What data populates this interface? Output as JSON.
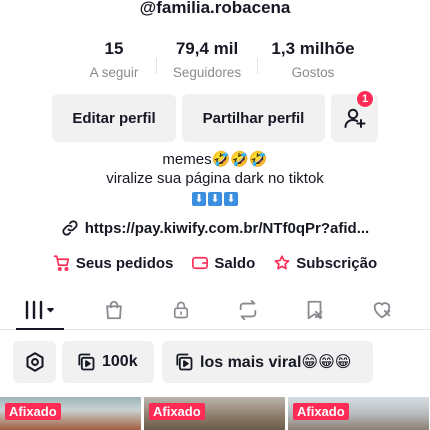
{
  "profile": {
    "username": "@familia.robacena"
  },
  "stats": [
    {
      "value": "15",
      "label": "A seguir"
    },
    {
      "value": "79,4 mil",
      "label": "Seguidores"
    },
    {
      "value": "1,3 milhõe",
      "label": "Gostos"
    }
  ],
  "actions": {
    "edit_label": "Editar perfil",
    "share_label": "Partilhar perfil",
    "add_friends_badge": "1"
  },
  "bio": {
    "line1": "memes🤣🤣🤣",
    "line2": "viralize sua página dark no tiktok",
    "arrows": [
      "⬇",
      "⬇",
      "⬇"
    ]
  },
  "link": {
    "text": "https://pay.kiwify.com.br/NTf0qPr?afid..."
  },
  "quick_links": [
    {
      "label": "Seus pedidos",
      "icon": "cart-icon"
    },
    {
      "label": "Saldo",
      "icon": "wallet-icon"
    },
    {
      "label": "Subscrição",
      "icon": "star-badge-icon"
    }
  ],
  "tabs": [
    {
      "icon": "grid-filter-icon",
      "active": true
    },
    {
      "icon": "shopping-bag-icon"
    },
    {
      "icon": "lock-icon"
    },
    {
      "icon": "repost-icon"
    },
    {
      "icon": "bookmark-icon"
    },
    {
      "icon": "heart-icon"
    }
  ],
  "playlists": [
    {
      "icon": "settings-icon",
      "label": ""
    },
    {
      "icon": "playlist-icon",
      "label": "100k"
    },
    {
      "icon": "playlist-icon",
      "label": "los mais viral😁😁😁"
    }
  ],
  "videos": [
    {
      "pinned_label": "Afixado"
    },
    {
      "pinned_label": "Afixado"
    },
    {
      "pinned_label": "Afixado"
    }
  ],
  "colors": {
    "accent": "#fe2c55",
    "text": "#161823",
    "muted": "#8a8b91",
    "button_bg": "#f1f1f2"
  }
}
